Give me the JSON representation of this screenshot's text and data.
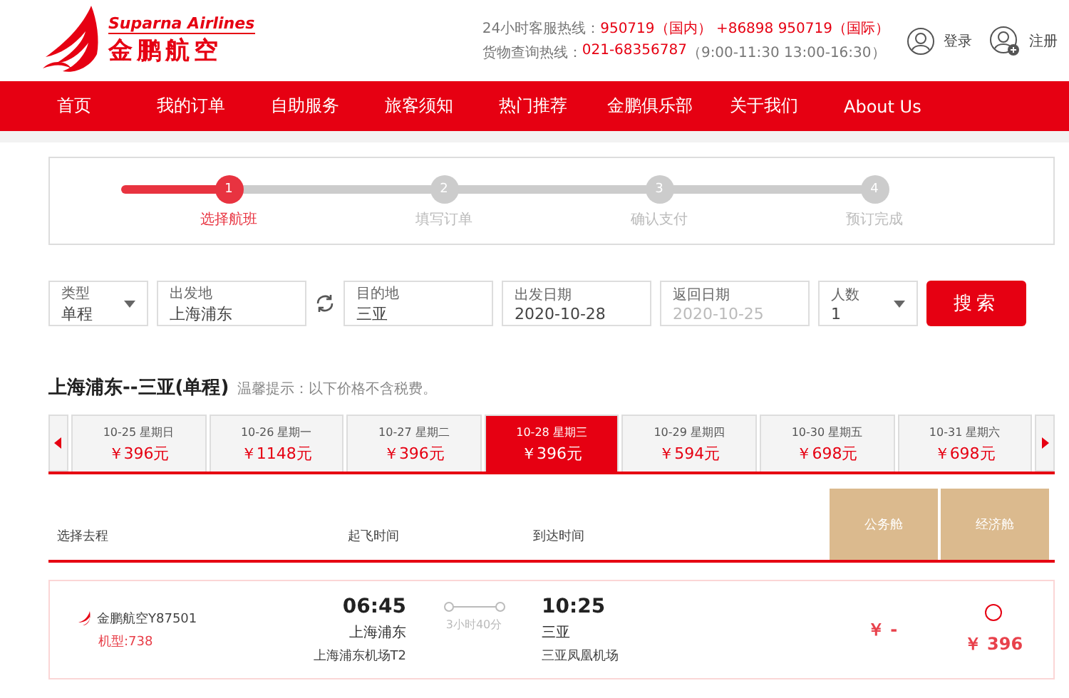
{
  "header": {
    "logo": {
      "en": "Suparna Airlines",
      "zh": "金鹏航空"
    },
    "hotlines": [
      {
        "label": "24小时客服热线：",
        "value": "950719（国内） +86898 950719（国际）"
      },
      {
        "label": "货物查询热线：",
        "value": "021-68356787",
        "note": "（9:00-11:30 13:00-16:30）"
      }
    ],
    "login": "登录",
    "register": "注册"
  },
  "nav": [
    "首页",
    "我的订单",
    "自助服务",
    "旅客须知",
    "热门推荐",
    "金鹏俱乐部",
    "关于我们",
    "About Us"
  ],
  "steps": [
    {
      "number": "1",
      "label": "选择航班",
      "active": true
    },
    {
      "number": "2",
      "label": "填写订单",
      "active": false
    },
    {
      "number": "3",
      "label": "确认支付",
      "active": false
    },
    {
      "number": "4",
      "label": "预订完成",
      "active": false
    }
  ],
  "search": {
    "fields": [
      {
        "kind": "select",
        "label": "类型",
        "value": "单程",
        "disabled": false
      },
      {
        "kind": "input",
        "label": "出发地",
        "value": "上海浦东",
        "disabled": false
      },
      {
        "kind": "swap"
      },
      {
        "kind": "input",
        "label": "目的地",
        "value": "三亚",
        "disabled": false
      },
      {
        "kind": "input",
        "label": "出发日期",
        "value": "2020-10-28",
        "disabled": false
      },
      {
        "kind": "input",
        "label": "返回日期",
        "value": "2020-10-25",
        "disabled": true
      },
      {
        "kind": "select",
        "label": "人数",
        "value": "1",
        "disabled": false
      }
    ],
    "button": "搜索"
  },
  "route": {
    "title": "上海浦东--三亚(单程)",
    "tip": "温馨提示：以下价格不含税费。"
  },
  "dates": [
    {
      "date": "10-25 星期日",
      "price": "￥396元",
      "selected": false
    },
    {
      "date": "10-26 星期一",
      "price": "￥1148元",
      "selected": false
    },
    {
      "date": "10-27 星期二",
      "price": "￥396元",
      "selected": false
    },
    {
      "date": "10-28 星期三",
      "price": "￥396元",
      "selected": true
    },
    {
      "date": "10-29 星期四",
      "price": "￥594元",
      "selected": false
    },
    {
      "date": "10-30 星期五",
      "price": "￥698元",
      "selected": false
    },
    {
      "date": "10-31 星期六",
      "price": "￥698元",
      "selected": false
    }
  ],
  "table": {
    "columns": [
      "选择去程",
      "起飞时间",
      "到达时间"
    ],
    "cabins": [
      "公务舱",
      "经济舱"
    ],
    "flights": [
      {
        "airline": "金鹏航空Y87501",
        "model": "机型:738",
        "depart_time": "06:45",
        "depart_city": "上海浦东",
        "depart_airport": "上海浦东机场T2",
        "duration": "3小时40分",
        "arrive_time": "10:25",
        "arrive_city": "三亚",
        "arrive_airport": "三亚凤凰机场",
        "business_price": "￥ -",
        "economy_price": "￥ 396",
        "economy_selected": false
      }
    ]
  }
}
